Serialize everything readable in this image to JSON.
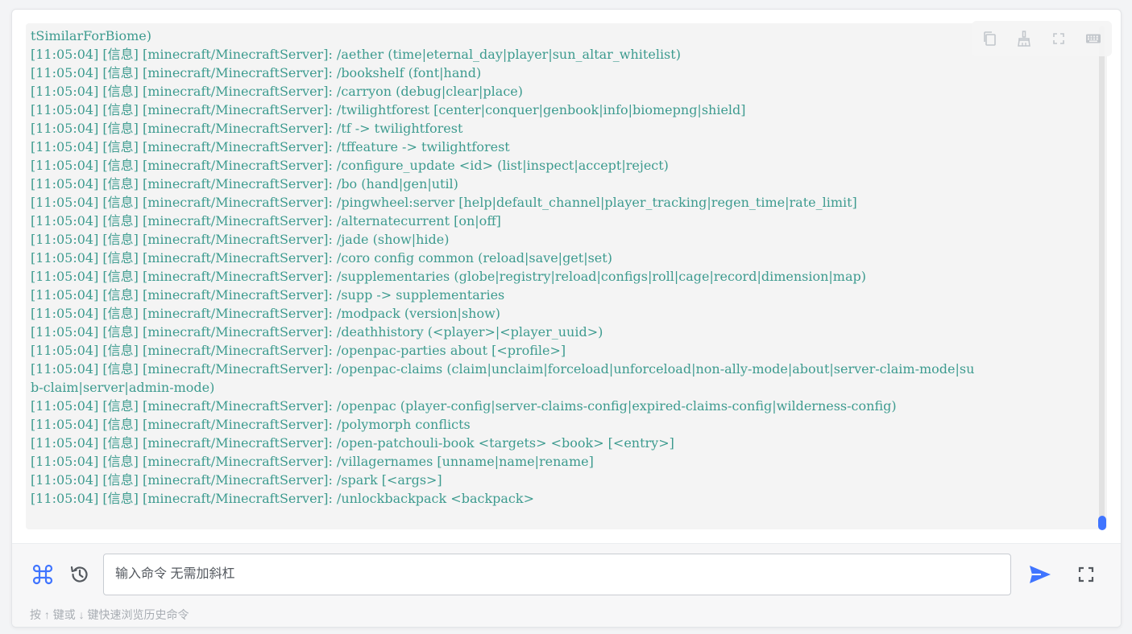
{
  "console": {
    "lines": [
      "tSimilarForBiome)",
      "[11:05:04] [信息] [minecraft/MinecraftServer]: /aether (time|eternal_day|player|sun_altar_whitelist)",
      "[11:05:04] [信息] [minecraft/MinecraftServer]: /bookshelf (font|hand)",
      "[11:05:04] [信息] [minecraft/MinecraftServer]: /carryon (debug|clear|place)",
      "[11:05:04] [信息] [minecraft/MinecraftServer]: /twilightforest [center|conquer|genbook|info|biomepng|shield]",
      "[11:05:04] [信息] [minecraft/MinecraftServer]: /tf -> twilightforest",
      "[11:05:04] [信息] [minecraft/MinecraftServer]: /tffeature -> twilightforest",
      "[11:05:04] [信息] [minecraft/MinecraftServer]: /configure_update <id> (list|inspect|accept|reject)",
      "[11:05:04] [信息] [minecraft/MinecraftServer]: /bo (hand|gen|util)",
      "[11:05:04] [信息] [minecraft/MinecraftServer]: /pingwheel:server [help|default_channel|player_tracking|regen_time|rate_limit]",
      "[11:05:04] [信息] [minecraft/MinecraftServer]: /alternatecurrent [on|off]",
      "[11:05:04] [信息] [minecraft/MinecraftServer]: /jade (show|hide)",
      "[11:05:04] [信息] [minecraft/MinecraftServer]: /coro config common (reload|save|get|set)",
      "[11:05:04] [信息] [minecraft/MinecraftServer]: /supplementaries (globe|registry|reload|configs|roll|cage|record|dimension|map)",
      "[11:05:04] [信息] [minecraft/MinecraftServer]: /supp -> supplementaries",
      "[11:05:04] [信息] [minecraft/MinecraftServer]: /modpack (version|show)",
      "[11:05:04] [信息] [minecraft/MinecraftServer]: /deathhistory (<player>|<player_uuid>)",
      "[11:05:04] [信息] [minecraft/MinecraftServer]: /openpac-parties about [<profile>]",
      "[11:05:04] [信息] [minecraft/MinecraftServer]: /openpac-claims (claim|unclaim|forceload|unforceload|non-ally-mode|about|server-claim-mode|su",
      "b-claim|server|admin-mode)",
      "[11:05:04] [信息] [minecraft/MinecraftServer]: /openpac (player-config|server-claims-config|expired-claims-config|wilderness-config)",
      "[11:05:04] [信息] [minecraft/MinecraftServer]: /polymorph conflicts",
      "[11:05:04] [信息] [minecraft/MinecraftServer]: /open-patchouli-book <targets> <book> [<entry>]",
      "[11:05:04] [信息] [minecraft/MinecraftServer]: /villagernames [unname|name|rename]",
      "[11:05:04] [信息] [minecraft/MinecraftServer]: /spark [<args>]",
      "[11:05:04] [信息] [minecraft/MinecraftServer]: /unlockbackpack <backpack>"
    ],
    "text_color": "#3d9b8f"
  },
  "toolbar": {
    "icons": [
      "copy-icon",
      "clear-broom-icon",
      "fullscreen-icon",
      "keyboard-icon"
    ]
  },
  "input": {
    "placeholder": "输入命令 无需加斜杠",
    "value": "",
    "hint": "按 ↑ 键或 ↓ 键快速浏览历史命令"
  },
  "colors": {
    "accent": "#3f74ff",
    "icon_gray": "#c2c6cb",
    "icon_dark": "#555a60"
  }
}
